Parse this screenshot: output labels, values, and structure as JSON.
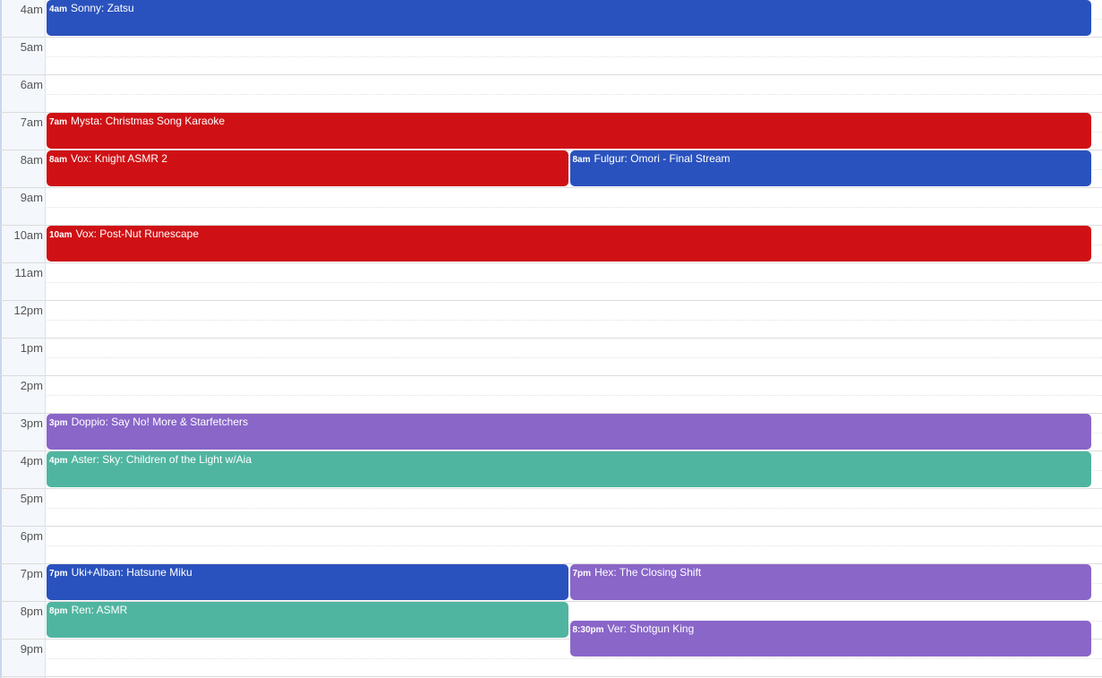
{
  "hours": [
    "4am",
    "5am",
    "6am",
    "7am",
    "8am",
    "9am",
    "10am",
    "11am",
    "12pm",
    "1pm",
    "2pm",
    "3pm",
    "4pm",
    "5pm",
    "6pm",
    "7pm",
    "8pm",
    "9pm"
  ],
  "colors": {
    "blue": "#2a52be",
    "red": "#cf1115",
    "purple": "#8966c8",
    "teal": "#50b5a0"
  },
  "events": [
    {
      "time": "4am",
      "title": "Sonny: Zatsu",
      "start": 4,
      "column": 0,
      "columns": 1,
      "color": "blue"
    },
    {
      "time": "7am",
      "title": "Mysta: Christmas Song Karaoke",
      "start": 7,
      "column": 0,
      "columns": 1,
      "color": "red"
    },
    {
      "time": "8am",
      "title": "Vox: Knight ASMR 2",
      "start": 8,
      "column": 0,
      "columns": 2,
      "color": "red"
    },
    {
      "time": "8am",
      "title": "Fulgur: Omori - Final Stream",
      "start": 8,
      "column": 1,
      "columns": 2,
      "color": "blue"
    },
    {
      "time": "10am",
      "title": "Vox: Post-Nut Runescape",
      "start": 10,
      "column": 0,
      "columns": 1,
      "color": "red"
    },
    {
      "time": "3pm",
      "title": "Doppio: Say No! More & Starfetchers",
      "start": 15,
      "column": 0,
      "columns": 1,
      "color": "purple"
    },
    {
      "time": "4pm",
      "title": "Aster: Sky: Children of the Light w/Aia",
      "start": 16,
      "column": 0,
      "columns": 1,
      "color": "teal"
    },
    {
      "time": "7pm",
      "title": "Uki+Alban: Hatsune Miku",
      "start": 19,
      "column": 0,
      "columns": 2,
      "color": "blue"
    },
    {
      "time": "7pm",
      "title": "Hex: The Closing Shift",
      "start": 19,
      "column": 1,
      "columns": 2,
      "color": "purple"
    },
    {
      "time": "8pm",
      "title": "Ren: ASMR",
      "start": 20,
      "column": 0,
      "columns": 2,
      "color": "teal"
    },
    {
      "time": "8:30pm",
      "title": "Ver: Shotgun King",
      "start": 20.5,
      "column": 1,
      "columns": 2,
      "color": "purple"
    }
  ]
}
